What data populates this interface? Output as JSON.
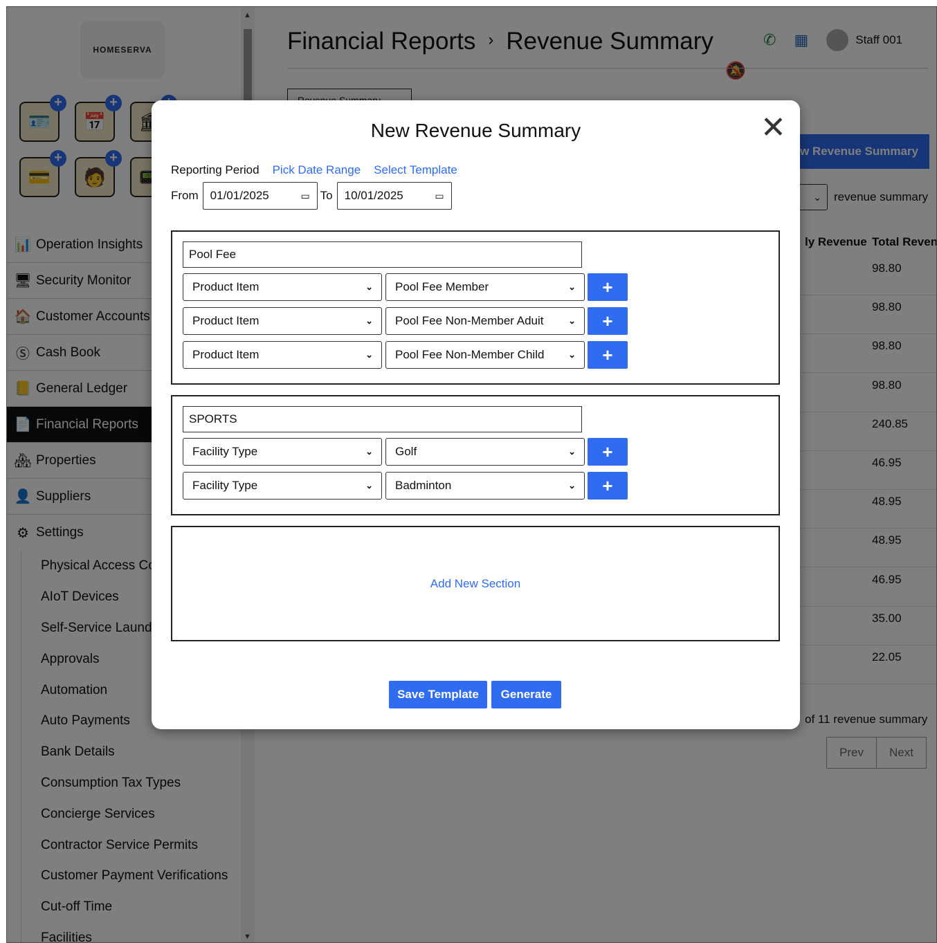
{
  "app": {
    "logo_text": "HOMESERVA"
  },
  "sidebar": {
    "quick_icons": [
      {
        "icon": "id-card-icon",
        "glyph": "🪪"
      },
      {
        "icon": "calendar-icon",
        "glyph": "📅"
      },
      {
        "icon": "bank-icon",
        "glyph": "🏛"
      },
      {
        "icon": "key-card-icon",
        "glyph": "💳"
      },
      {
        "icon": "person-icon",
        "glyph": "🧑"
      },
      {
        "icon": "reader-icon",
        "glyph": "📟"
      }
    ],
    "menu": [
      {
        "label": "Operation Insights",
        "icon": "chart-icon",
        "glyph": "📊"
      },
      {
        "label": "Security Monitor",
        "icon": "monitor-icon",
        "glyph": "🖥"
      },
      {
        "label": "Customer Accounts",
        "icon": "home-icon",
        "glyph": "🏠"
      },
      {
        "label": "Cash Book",
        "icon": "dollar-icon",
        "glyph": "Ⓢ"
      },
      {
        "label": "General Ledger",
        "icon": "ledger-icon",
        "glyph": "📒"
      },
      {
        "label": "Financial Reports",
        "icon": "report-icon",
        "glyph": "📄"
      },
      {
        "label": "Properties",
        "icon": "house-icon",
        "glyph": "🏘"
      },
      {
        "label": "Suppliers",
        "icon": "supplier-icon",
        "glyph": "👤"
      },
      {
        "label": "Settings",
        "icon": "gear-icon",
        "glyph": "⚙"
      }
    ],
    "submenu": [
      "Physical Access Cc",
      "AIoT Devices",
      "Self-Service Laund",
      "Approvals",
      "Automation",
      "Auto Payments",
      "Bank Details",
      "Consumption Tax Types",
      "Concierge Services",
      "Contractor Service Permits",
      "Customer Payment Verifications",
      "Cut-off Time",
      "Facilities"
    ]
  },
  "header": {
    "crumb_parent": "Financial Reports",
    "crumb_sep": "›",
    "crumb_current": "Revenue Summary",
    "staff_name": "Staff 001"
  },
  "background": {
    "tab_label": "Revenue Summary",
    "new_button": "ew Revenue Summary",
    "filter_label": "revenue summary",
    "col_monthly": "ly Revenue",
    "col_total": "Total Reven",
    "values": [
      "98.80",
      "98.80",
      "98.80",
      "98.80",
      "240.85",
      "46.95",
      "48.95",
      "48.95",
      "46.95",
      "35.00",
      "22.05"
    ],
    "pager_text": "of 11 revenue summary",
    "prev": "Prev",
    "next": "Next"
  },
  "modal": {
    "title": "New Revenue Summary",
    "reporting_period": "Reporting Period",
    "pick_date_range": "Pick Date Range",
    "select_template": "Select Template",
    "from_label": "From",
    "from_value": "01/01/2025",
    "to_label": "To",
    "to_value": "10/01/2025",
    "sections": [
      {
        "name": "Pool Fee",
        "rows": [
          {
            "type": "Product Item",
            "value": "Pool Fee Member"
          },
          {
            "type": "Product Item",
            "value": "Pool Fee Non-Member Aduit"
          },
          {
            "type": "Product Item",
            "value": "Pool Fee Non-Member Child"
          }
        ]
      },
      {
        "name": "SPORTS",
        "rows": [
          {
            "type": "Facility Type",
            "value": "Golf"
          },
          {
            "type": "Facility Type",
            "value": "Badminton"
          }
        ]
      }
    ],
    "add_section": "Add New Section",
    "save_template": "Save Template",
    "generate": "Generate",
    "plus_glyph": "+"
  }
}
